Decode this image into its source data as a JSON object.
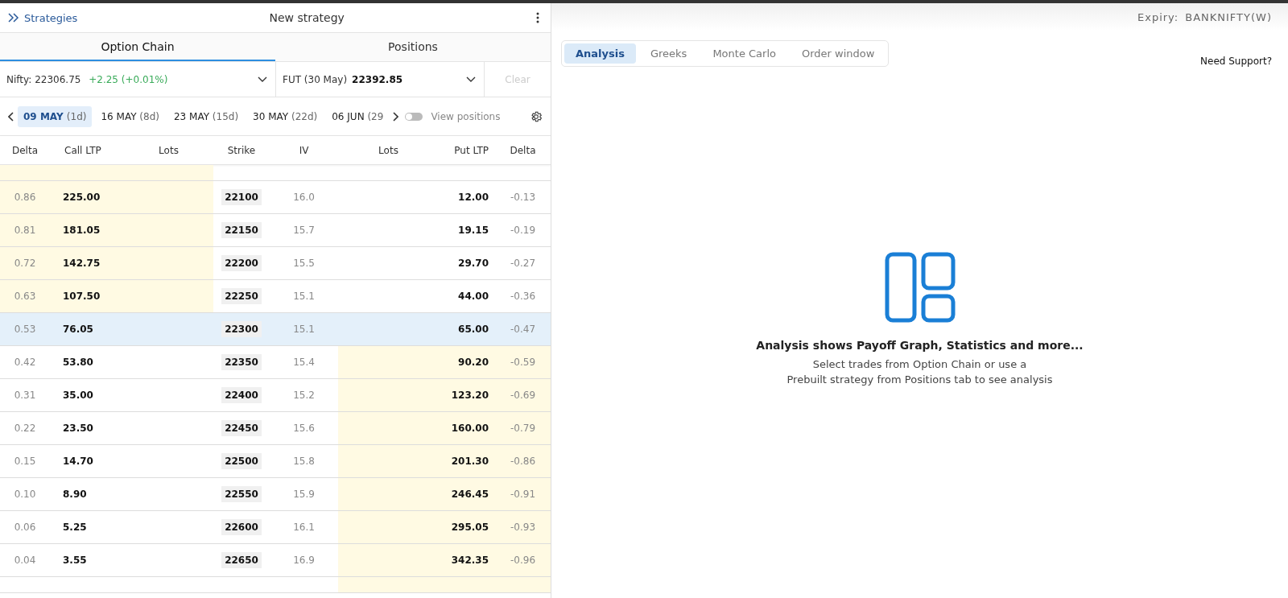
{
  "header": {
    "back_label": "Strategies",
    "title": "New strategy"
  },
  "tabs": [
    {
      "label": "Option Chain",
      "selected": true
    },
    {
      "label": "Positions",
      "selected": false
    }
  ],
  "spot": {
    "label": "Nifty:",
    "price": "22306.75",
    "change": "+2.25 (+0.01%)"
  },
  "futures": {
    "label": "FUT (30 May)",
    "price": "22392.85"
  },
  "clear_button": {
    "label": "Clear",
    "disabled": true
  },
  "expiries": [
    {
      "date": "09 MAY",
      "days": "(1d)",
      "selected": true
    },
    {
      "date": "16 MAY",
      "days": "(8d)",
      "selected": false
    },
    {
      "date": "23 MAY",
      "days": "(15d)",
      "selected": false
    },
    {
      "date": "30 MAY",
      "days": "(22d)",
      "selected": false
    },
    {
      "date": "06 JUN",
      "days": "(29",
      "selected": false
    }
  ],
  "view_positions": {
    "label": "View positions",
    "on": false
  },
  "columns": [
    "Delta",
    "Call LTP",
    "Lots",
    "Strike",
    "IV",
    "Lots",
    "Put LTP",
    "Delta"
  ],
  "rows": [
    {
      "call_delta": "0.86",
      "call_ltp": "225.00",
      "strike": "22100",
      "iv": "16.0",
      "put_ltp": "12.00",
      "put_delta": "-0.13",
      "call_itm": true,
      "put_itm": false,
      "atm": false
    },
    {
      "call_delta": "0.81",
      "call_ltp": "181.05",
      "strike": "22150",
      "iv": "15.7",
      "put_ltp": "19.15",
      "put_delta": "-0.19",
      "call_itm": true,
      "put_itm": false,
      "atm": false
    },
    {
      "call_delta": "0.72",
      "call_ltp": "142.75",
      "strike": "22200",
      "iv": "15.5",
      "put_ltp": "29.70",
      "put_delta": "-0.27",
      "call_itm": true,
      "put_itm": false,
      "atm": false
    },
    {
      "call_delta": "0.63",
      "call_ltp": "107.50",
      "strike": "22250",
      "iv": "15.1",
      "put_ltp": "44.00",
      "put_delta": "-0.36",
      "call_itm": true,
      "put_itm": false,
      "atm": false
    },
    {
      "call_delta": "0.53",
      "call_ltp": "76.05",
      "strike": "22300",
      "iv": "15.1",
      "put_ltp": "65.00",
      "put_delta": "-0.47",
      "call_itm": false,
      "put_itm": false,
      "atm": true
    },
    {
      "call_delta": "0.42",
      "call_ltp": "53.80",
      "strike": "22350",
      "iv": "15.4",
      "put_ltp": "90.20",
      "put_delta": "-0.59",
      "call_itm": false,
      "put_itm": true,
      "atm": false
    },
    {
      "call_delta": "0.31",
      "call_ltp": "35.00",
      "strike": "22400",
      "iv": "15.2",
      "put_ltp": "123.20",
      "put_delta": "-0.69",
      "call_itm": false,
      "put_itm": true,
      "atm": false
    },
    {
      "call_delta": "0.22",
      "call_ltp": "23.50",
      "strike": "22450",
      "iv": "15.6",
      "put_ltp": "160.00",
      "put_delta": "-0.79",
      "call_itm": false,
      "put_itm": true,
      "atm": false
    },
    {
      "call_delta": "0.15",
      "call_ltp": "14.70",
      "strike": "22500",
      "iv": "15.8",
      "put_ltp": "201.30",
      "put_delta": "-0.86",
      "call_itm": false,
      "put_itm": true,
      "atm": false
    },
    {
      "call_delta": "0.10",
      "call_ltp": "8.90",
      "strike": "22550",
      "iv": "15.9",
      "put_ltp": "246.45",
      "put_delta": "-0.91",
      "call_itm": false,
      "put_itm": true,
      "atm": false
    },
    {
      "call_delta": "0.06",
      "call_ltp": "5.25",
      "strike": "22600",
      "iv": "16.1",
      "put_ltp": "295.05",
      "put_delta": "-0.93",
      "call_itm": false,
      "put_itm": true,
      "atm": false
    },
    {
      "call_delta": "0.04",
      "call_ltp": "3.55",
      "strike": "22650",
      "iv": "16.9",
      "put_ltp": "342.35",
      "put_delta": "-0.96",
      "call_itm": false,
      "put_itm": true,
      "atm": false
    }
  ],
  "expiry": {
    "label": "Expiry:",
    "value": "BANKNIFTY(W)"
  },
  "analysis_tabs": [
    {
      "label": "Analysis",
      "selected": true
    },
    {
      "label": "Greeks",
      "selected": false
    },
    {
      "label": "Monte Carlo",
      "selected": false
    },
    {
      "label": "Order window",
      "selected": false
    }
  ],
  "support_link": "Need Support?",
  "empty_state": {
    "title": "Analysis shows Payoff Graph, Statistics and more...",
    "lines": [
      "Select trades from Option Chain or use a",
      "Prebuilt strategy from Positions tab to see analysis"
    ]
  }
}
